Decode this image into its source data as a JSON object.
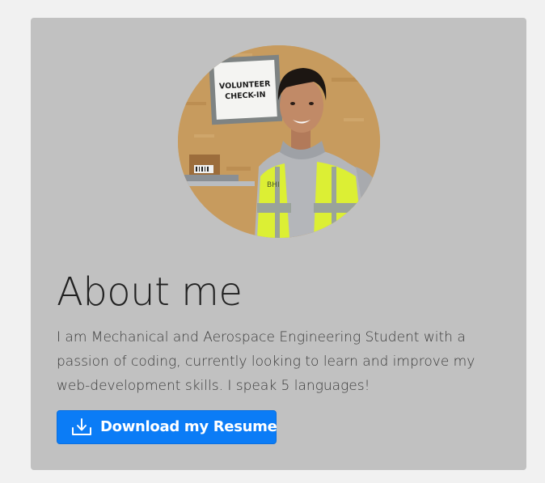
{
  "about": {
    "heading": "About me",
    "description": "I am Mechanical and Aerospace Engineering Student with a passion of coding, currently looking to learn and improve my web-development skills. I speak 5 languages!",
    "photo": {
      "sign_line1": "VOLUNTEER",
      "sign_line2": "CHECK-IN",
      "vest_text": "BHI"
    },
    "download_button": {
      "label": "Download my Resume",
      "icon": "download-icon"
    }
  },
  "colors": {
    "page_background": "#f1f1f1",
    "card_background": "#c1c1c1",
    "button_accent": "#0b7cf6"
  }
}
